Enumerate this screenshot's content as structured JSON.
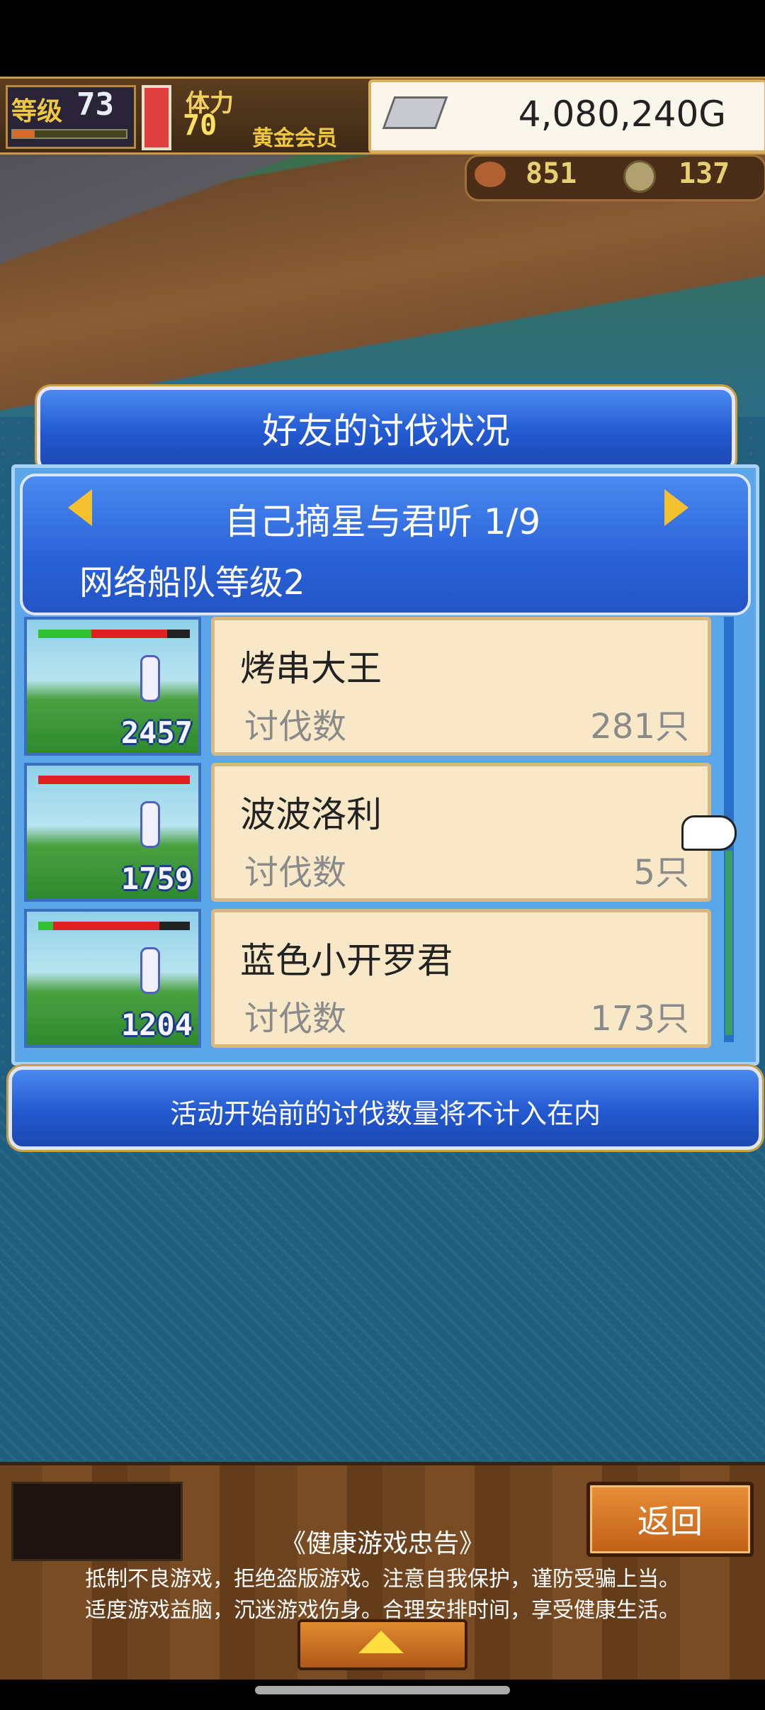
{
  "hud": {
    "level_label": "等级",
    "level_value": "73",
    "level_progress": 0.2,
    "stamina_label": "体力",
    "stamina_value": "70",
    "membership": "黄金会员",
    "gold": "4,080,240G",
    "resource1": "851",
    "resource2": "137",
    "icons": [
      "silver-bar-icon",
      "meat-icon",
      "coin-icon"
    ]
  },
  "panel": {
    "title": "好友的讨伐状况",
    "friend_name": "自己摘星与君听 1/9",
    "fleet_level": "网络船队等级2",
    "rows": [
      {
        "name": "烤串大王",
        "label": "讨伐数",
        "count": "281只",
        "thumb_number": "2457",
        "hp": 0.35,
        "bar": 0.85
      },
      {
        "name": "波波洛利",
        "label": "讨伐数",
        "count": "5只",
        "thumb_number": "1759",
        "hp": 0,
        "bar": 1.0
      },
      {
        "name": "蓝色小开罗君",
        "label": "讨伐数",
        "count": "173只",
        "thumb_number": "1204",
        "hp": 0.1,
        "bar": 0.8
      }
    ],
    "notice": "活动开始前的讨伐数量将不计入在内"
  },
  "footer": {
    "back_label": "返回",
    "health_title": "《健康游戏忠告》",
    "health_line1": "抵制不良游戏，拒绝盗版游戏。注意自我保护，谨防受骗上当。",
    "health_line2": "适度游戏益脑，沉迷游戏伤身。合理安排时间，享受健康生活。"
  },
  "colors": {
    "panel_blue": "#2258d0",
    "card_bg": "#f8e8c8",
    "gold_text": "#f0c840"
  }
}
